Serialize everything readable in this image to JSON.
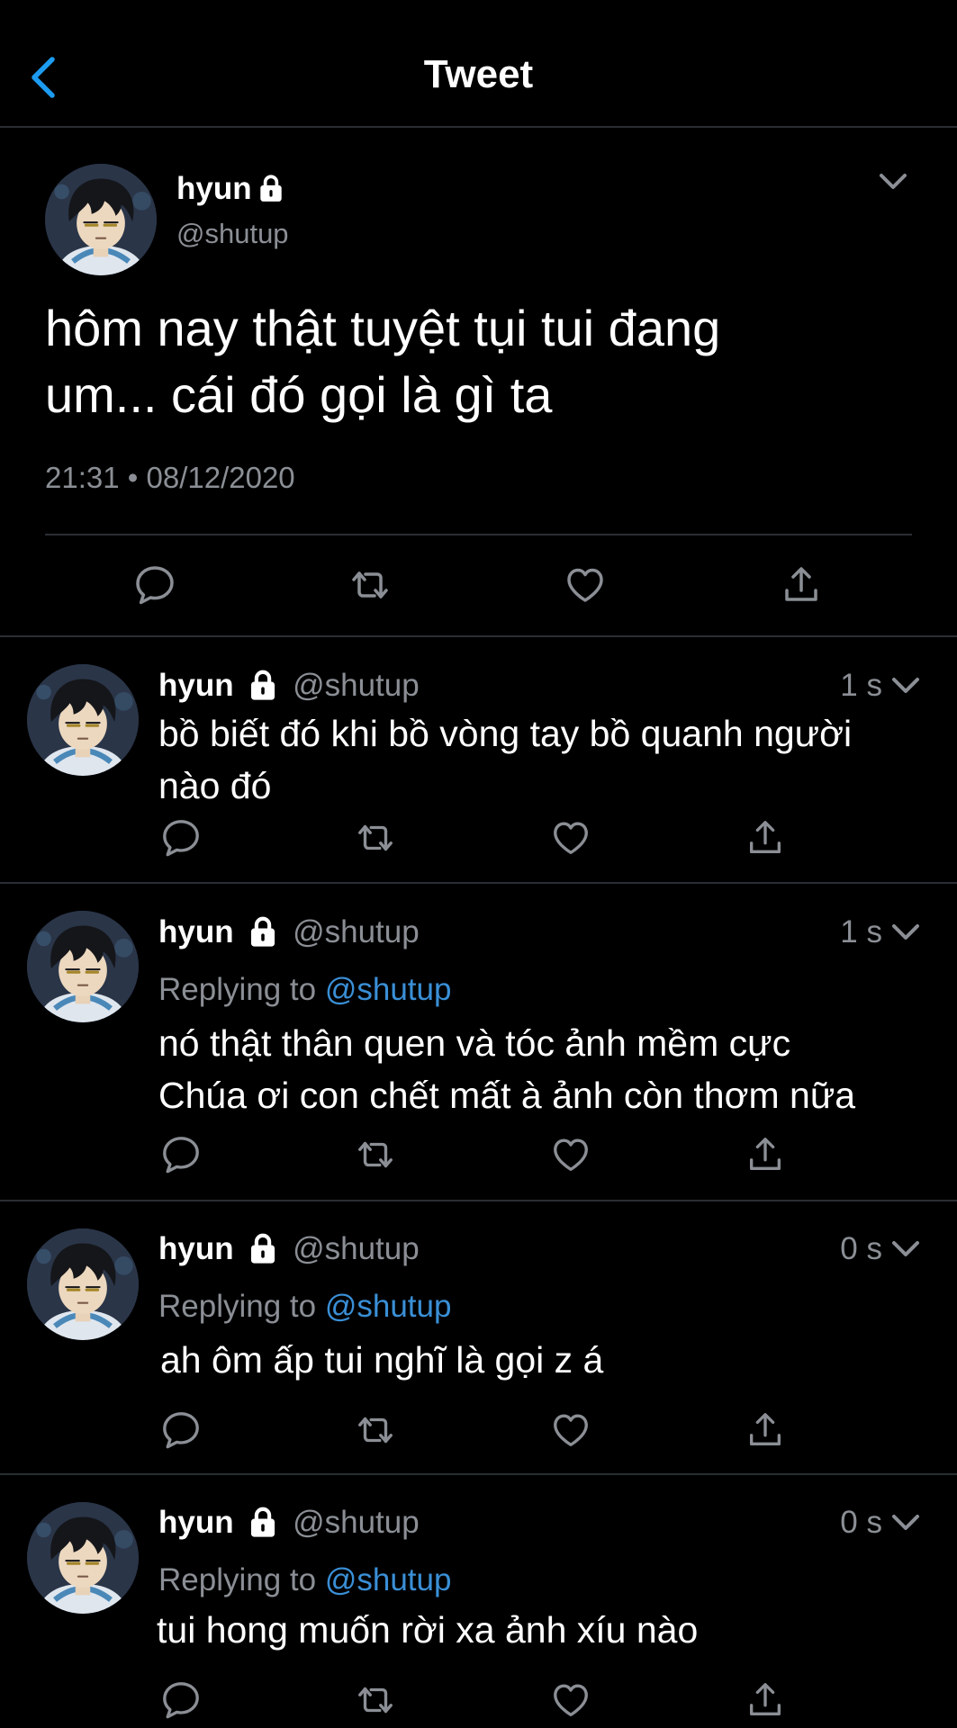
{
  "header": {
    "title": "Tweet"
  },
  "main_tweet": {
    "name": "hyun",
    "handle": "@shutup",
    "text_line1": "hôm nay thật tuyệt tụi tui đang",
    "text_line2": "um... cái đó gọi là gì ta",
    "time": "21:31",
    "separator": "•",
    "date": "08/12/2020"
  },
  "replies": [
    {
      "name": "hyun",
      "handle": "@shutup",
      "time": "1 s",
      "replying_prefix": "",
      "replying_handle": "",
      "line1": "bồ biết đó khi bồ vòng tay bồ quanh người",
      "line2": "nào đó"
    },
    {
      "name": "hyun",
      "handle": "@shutup",
      "time": "1 s",
      "replying_prefix": "Replying to",
      "replying_handle": "@shutup",
      "line1": "nó thật thân quen và tóc ảnh mềm cực",
      "line2": "Chúa ơi con chết mất à ảnh còn thơm nữa"
    },
    {
      "name": "hyun",
      "handle": "@shutup",
      "time": "0 s",
      "replying_prefix": "Replying to",
      "replying_handle": "@shutup",
      "line1": "ah ôm ấp tui nghĩ là gọi z á",
      "line2": ""
    },
    {
      "name": "hyun",
      "handle": "@shutup",
      "time": "0 s",
      "replying_prefix": "Replying to",
      "replying_handle": "@shutup",
      "line1": "tui hong muốn rời xa ảnh xíu nào",
      "line2": ""
    }
  ],
  "icons": {
    "back": "chevron-left-icon",
    "lock": "lock-icon",
    "more": "chevron-down-icon",
    "reply": "reply-icon",
    "retweet": "retweet-icon",
    "like": "heart-icon",
    "share": "share-icon"
  },
  "colors": {
    "background": "#000000",
    "accent": "#1d9bf0",
    "muted": "#8b8f95",
    "divider": "#2a2e33"
  }
}
